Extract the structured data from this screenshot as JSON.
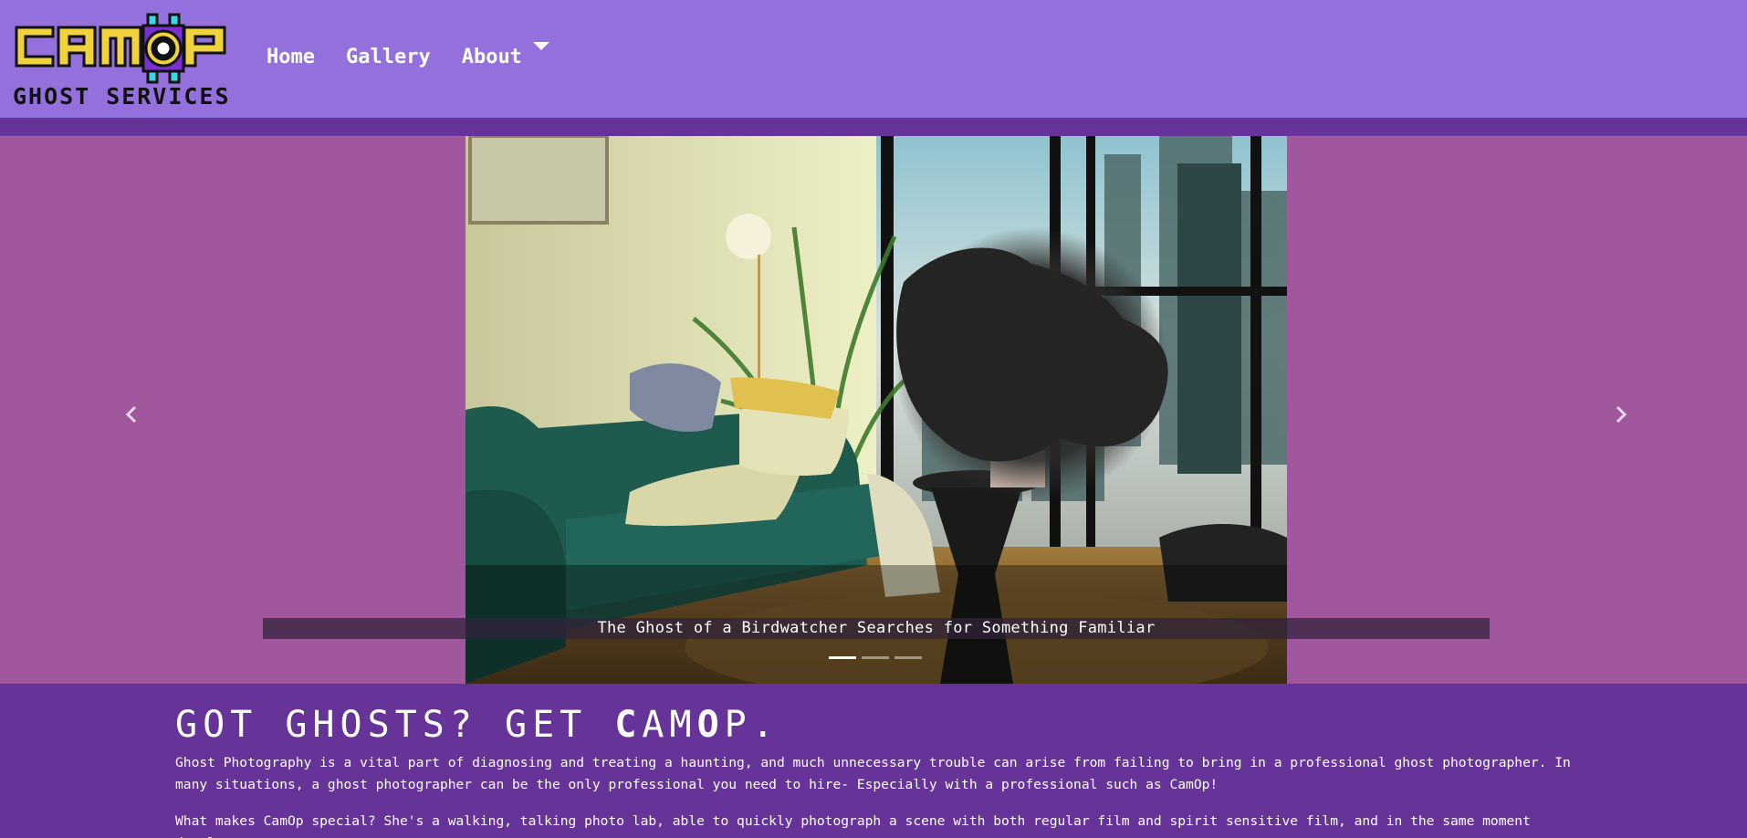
{
  "brand": {
    "logo_top": "CAM OP",
    "logo_bottom": "GHOST SERVICES"
  },
  "nav": {
    "items": [
      {
        "label": "Home"
      },
      {
        "label": "Gallery"
      },
      {
        "label": "About"
      }
    ],
    "about_dropdown_icon": "caret-down-icon"
  },
  "carousel": {
    "caption": "The Ghost of a Birdwatcher Searches for Something Familiar",
    "slide_count": 3,
    "active_index": 0,
    "prev_icon": "chevron-left-icon",
    "next_icon": "chevron-right-icon"
  },
  "main": {
    "headline_parts": [
      "GOT GHOSTS? GET ",
      "C",
      "AM",
      "O",
      "P."
    ],
    "paragraphs": [
      "Ghost Photography is a vital part of diagnosing and treating a haunting, and much unnecessary trouble can arise from failing to bring in a professional ghost photographer. In many situations, a ghost photographer can be the only professional you need to hire- Especially with a professional such as CamOp!",
      "What makes CamOp special? She's a walking, talking photo lab, able to quickly photograph a scene with both regular film and spirit sensitive film, and in the same moment develop"
    ]
  },
  "colors": {
    "navbar": "#9370db",
    "band": "#663399",
    "carousel_bg": "#a0579d",
    "logo_yellow": "#f0d23c",
    "logo_cyan": "#3ad6e6",
    "logo_purple": "#7a2fd0"
  }
}
